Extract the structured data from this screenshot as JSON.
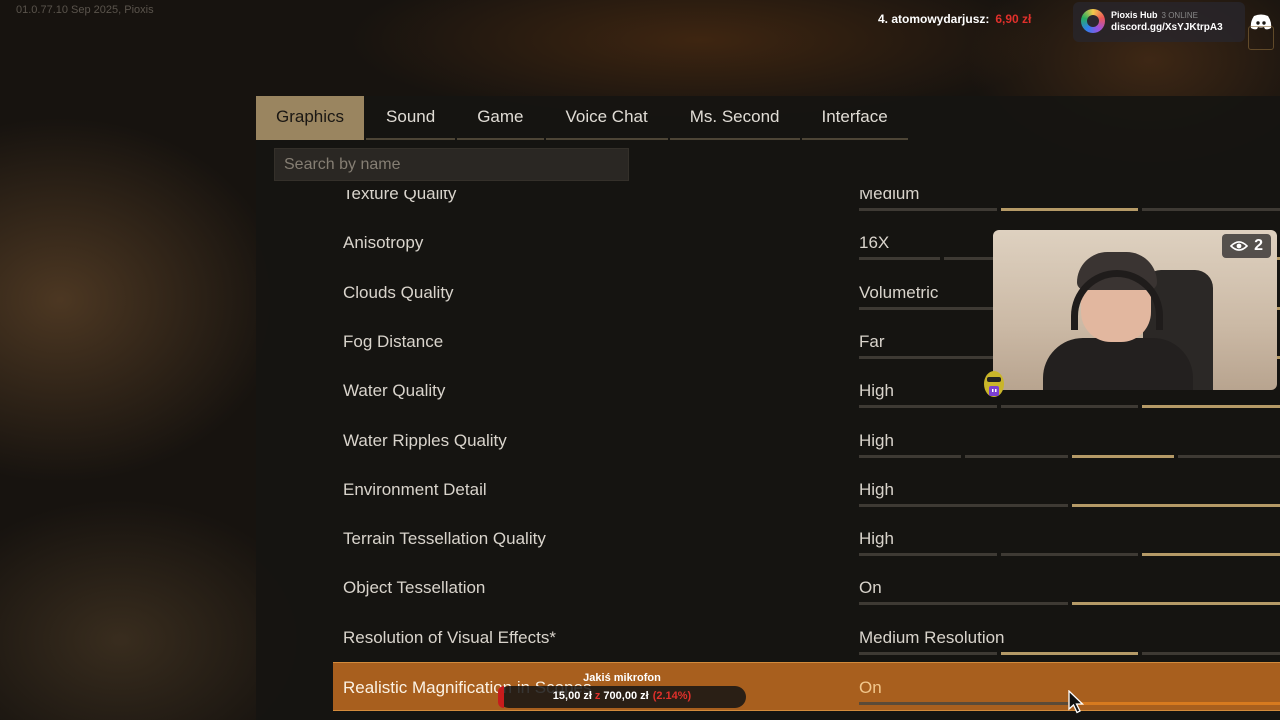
{
  "watermark": "01.0.77.10 Sep 2025, Pioxis",
  "donor": {
    "name": "4. atomowydarjusz:",
    "amount": "6,90 zł"
  },
  "hub": {
    "name": "Pioxis Hub",
    "online": "3 ONLINE",
    "link": "discord.gg/XsYJKtrpA3"
  },
  "tabs": [
    {
      "label": "Graphics",
      "active": true
    },
    {
      "label": "Sound"
    },
    {
      "label": "Game"
    },
    {
      "label": "Voice Chat"
    },
    {
      "label": "Ms. Second"
    },
    {
      "label": "Interface"
    }
  ],
  "search": {
    "placeholder": "Search by name",
    "value": ""
  },
  "settings": [
    {
      "name": "Texture Quality",
      "value": "Medium",
      "segments": 3,
      "selected": 1
    },
    {
      "name": "Anisotropy",
      "value": "16X",
      "segments": 5,
      "selected": 4
    },
    {
      "name": "Clouds Quality",
      "value": "Volumetric",
      "segments": 3,
      "selected": 2
    },
    {
      "name": "Fog Distance",
      "value": "Far",
      "segments": 3,
      "selected": 2
    },
    {
      "name": "Water Quality",
      "value": "High",
      "segments": 3,
      "selected": 2
    },
    {
      "name": "Water Ripples Quality",
      "value": "High",
      "segments": 4,
      "selected": 2
    },
    {
      "name": "Environment Detail",
      "value": "High",
      "segments": 2,
      "selected": 1
    },
    {
      "name": "Terrain Tessellation Quality",
      "value": "High",
      "segments": 3,
      "selected": 2
    },
    {
      "name": "Object Tessellation",
      "value": "On",
      "segments": 2,
      "selected": 1
    },
    {
      "name": "Resolution of Visual Effects*",
      "value": "Medium Resolution",
      "segments": 3,
      "selected": 1
    },
    {
      "name": "Realistic Magnification in Scopes",
      "value": "On",
      "segments": 2,
      "selected": 1,
      "highlighted": true
    }
  ],
  "webcam": {
    "viewers": "2"
  },
  "goal": {
    "title": "Jakiś mikrofon",
    "current": "15,00 zł",
    "target": "700,00 zł",
    "percent": "(2.14%)",
    "progress": 0.0214
  },
  "colors": {
    "accent": "#9a8560",
    "highlight": "#a85f1e",
    "slider_on": "#b59a67",
    "goal_red": "#c71c1c"
  }
}
